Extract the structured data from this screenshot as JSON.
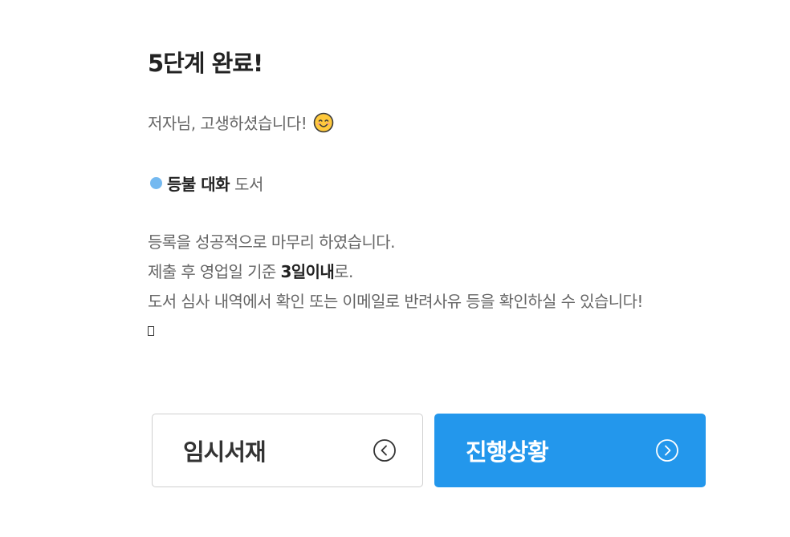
{
  "header": {
    "title": "5단계 완료!"
  },
  "greeting": {
    "text": "저자님, 고생하셨습니다!",
    "emoji_icon": "smiling-face-icon"
  },
  "book": {
    "title": "등불 대화",
    "suffix": "도서",
    "dot_color": "#74b9f0"
  },
  "message": {
    "line1": "등록을 성공적으로 마무리 하였습니다.",
    "line2_prefix": "제출 후 영업일 기준 ",
    "line2_emphasis": "3일이내",
    "line2_suffix": "로.",
    "line3": "도서 심사 내역에서 확인 또는 이메일로 반려사유 등을 확인하실 수 있습니다!"
  },
  "buttons": {
    "draft": {
      "label": "임시서재",
      "icon": "chevron-left-circle-icon"
    },
    "progress": {
      "label": "진행상황",
      "icon": "chevron-right-circle-icon",
      "color": "#2397ec"
    }
  }
}
